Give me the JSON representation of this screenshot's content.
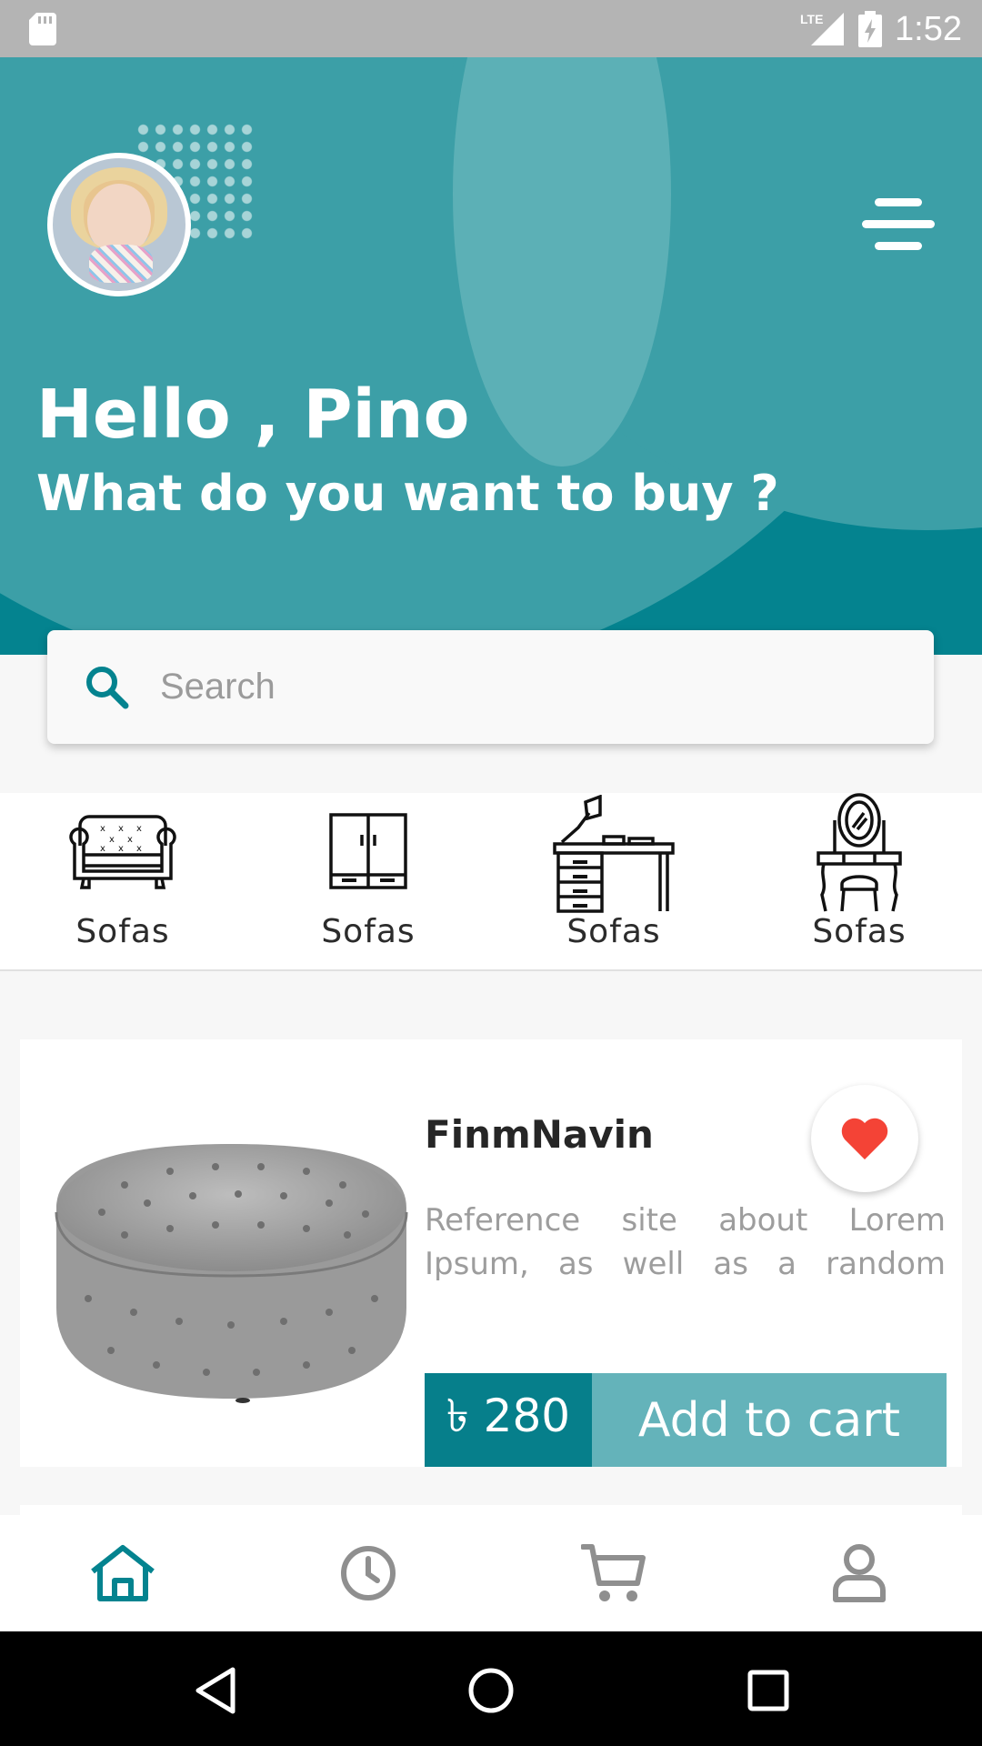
{
  "status_bar": {
    "time": "1:52",
    "network": "LTE"
  },
  "header": {
    "greeting": "Hello , Pino",
    "subtitle": "What do you want to buy ?",
    "background_color": "#04838f"
  },
  "search": {
    "placeholder": "Search"
  },
  "categories": [
    {
      "label": "Sofas",
      "icon": "sofa-icon"
    },
    {
      "label": "Sofas",
      "icon": "wardrobe-icon"
    },
    {
      "label": "Sofas",
      "icon": "desk-icon"
    },
    {
      "label": "Sofas",
      "icon": "dressing-table-icon"
    }
  ],
  "product": {
    "name": "FinmNavin",
    "description": "Reference site about Lorem Ipsum, as well as a random",
    "price": "৳ 280",
    "add_to_cart_label": "Add to cart",
    "favorite": true,
    "image": "tufted-ottoman-image"
  },
  "bottom_nav": [
    {
      "name": "home",
      "icon": "home-icon",
      "active": true
    },
    {
      "name": "history",
      "icon": "clock-icon",
      "active": false
    },
    {
      "name": "cart",
      "icon": "cart-icon",
      "active": false
    },
    {
      "name": "profile",
      "icon": "profile-icon",
      "active": false
    }
  ],
  "colors": {
    "primary": "#04838f",
    "accent_light": "#64b3ba",
    "heart": "#f44336"
  }
}
